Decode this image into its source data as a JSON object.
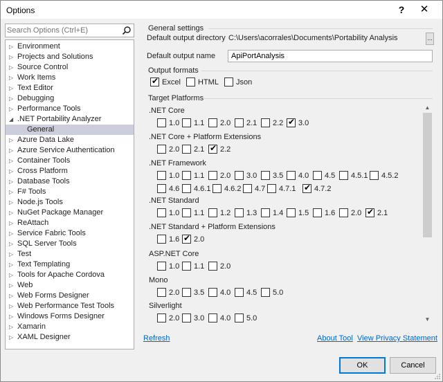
{
  "window": {
    "title": "Options",
    "help_glyph": "?",
    "close_glyph": "✕"
  },
  "search": {
    "placeholder": "Search Options (Ctrl+E)"
  },
  "tree": [
    {
      "label": "Environment",
      "expanded": false
    },
    {
      "label": "Projects and Solutions",
      "expanded": false
    },
    {
      "label": "Source Control",
      "expanded": false
    },
    {
      "label": "Work Items",
      "expanded": false
    },
    {
      "label": "Text Editor",
      "expanded": false
    },
    {
      "label": "Debugging",
      "expanded": false
    },
    {
      "label": "Performance Tools",
      "expanded": false
    },
    {
      "label": ".NET Portability Analyzer",
      "expanded": true
    },
    {
      "label": "General",
      "child": true,
      "selected": true
    },
    {
      "label": "Azure Data Lake",
      "expanded": false
    },
    {
      "label": "Azure Service Authentication",
      "expanded": false
    },
    {
      "label": "Container Tools",
      "expanded": false
    },
    {
      "label": "Cross Platform",
      "expanded": false
    },
    {
      "label": "Database Tools",
      "expanded": false
    },
    {
      "label": "F# Tools",
      "expanded": false
    },
    {
      "label": "Node.js Tools",
      "expanded": false
    },
    {
      "label": "NuGet Package Manager",
      "expanded": false
    },
    {
      "label": "ReAttach",
      "expanded": false
    },
    {
      "label": "Service Fabric Tools",
      "expanded": false
    },
    {
      "label": "SQL Server Tools",
      "expanded": false
    },
    {
      "label": "Test",
      "expanded": false
    },
    {
      "label": "Text Templating",
      "expanded": false
    },
    {
      "label": "Tools for Apache Cordova",
      "expanded": false
    },
    {
      "label": "Web",
      "expanded": false
    },
    {
      "label": "Web Forms Designer",
      "expanded": false
    },
    {
      "label": "Web Performance Test Tools",
      "expanded": false
    },
    {
      "label": "Windows Forms Designer",
      "expanded": false
    },
    {
      "label": "Xamarin",
      "expanded": false
    },
    {
      "label": "XAML Designer",
      "expanded": false
    }
  ],
  "general": {
    "title": "General settings",
    "dir_label": "Default output directory",
    "dir_value": "C:\\Users\\acorrales\\Documents\\Portability Analysis",
    "browse_label": "...",
    "name_label": "Default output name",
    "name_value": "ApiPortAnalysis"
  },
  "formats": {
    "title": "Output formats",
    "items": [
      {
        "label": "Excel",
        "checked": true
      },
      {
        "label": "HTML",
        "checked": false
      },
      {
        "label": "Json",
        "checked": false
      }
    ]
  },
  "platforms": {
    "title": "Target Platforms",
    "groups": [
      {
        "name": ".NET Core",
        "rows": [
          [
            {
              "v": "1.0",
              "c": false
            },
            {
              "v": "1.1",
              "c": false
            },
            {
              "v": "2.0",
              "c": false
            },
            {
              "v": "2.1",
              "c": false
            },
            {
              "v": "2.2",
              "c": false
            },
            {
              "v": "3.0",
              "c": true
            }
          ]
        ]
      },
      {
        "name": ".NET Core + Platform Extensions",
        "rows": [
          [
            {
              "v": "2.0",
              "c": false
            },
            {
              "v": "2.1",
              "c": false
            },
            {
              "v": "2.2",
              "c": true
            }
          ]
        ]
      },
      {
        "name": ".NET Framework",
        "rows": [
          [
            {
              "v": "1.0",
              "c": false
            },
            {
              "v": "1.1",
              "c": false
            },
            {
              "v": "2.0",
              "c": false
            },
            {
              "v": "3.0",
              "c": false
            },
            {
              "v": "3.5",
              "c": false
            },
            {
              "v": "4.0",
              "c": false
            },
            {
              "v": "4.5",
              "c": false
            },
            {
              "v": "4.5.1",
              "c": false
            },
            {
              "v": "4.5.2",
              "c": false
            }
          ],
          [
            {
              "v": "4.6",
              "c": false
            },
            {
              "v": "4.6.1",
              "c": false
            },
            {
              "v": "4.6.2",
              "c": false
            },
            {
              "v": "4.7",
              "c": false
            },
            {
              "v": "4.7.1",
              "c": false
            },
            {
              "v": "4.7.2",
              "c": true
            }
          ]
        ]
      },
      {
        "name": ".NET Standard",
        "rows": [
          [
            {
              "v": "1.0",
              "c": false
            },
            {
              "v": "1.1",
              "c": false
            },
            {
              "v": "1.2",
              "c": false
            },
            {
              "v": "1.3",
              "c": false
            },
            {
              "v": "1.4",
              "c": false
            },
            {
              "v": "1.5",
              "c": false
            },
            {
              "v": "1.6",
              "c": false
            },
            {
              "v": "2.0",
              "c": false
            },
            {
              "v": "2.1",
              "c": true
            }
          ]
        ]
      },
      {
        "name": ".NET Standard + Platform Extensions",
        "rows": [
          [
            {
              "v": "1.6",
              "c": false
            },
            {
              "v": "2.0",
              "c": true
            }
          ]
        ]
      },
      {
        "name": "ASP.NET Core",
        "rows": [
          [
            {
              "v": "1.0",
              "c": false
            },
            {
              "v": "1.1",
              "c": false
            },
            {
              "v": "2.0",
              "c": false
            }
          ]
        ]
      },
      {
        "name": "Mono",
        "rows": [
          [
            {
              "v": "2.0",
              "c": false
            },
            {
              "v": "3.5",
              "c": false
            },
            {
              "v": "4.0",
              "c": false
            },
            {
              "v": "4.5",
              "c": false
            },
            {
              "v": "5.0",
              "c": false
            }
          ]
        ]
      },
      {
        "name": "Silverlight",
        "rows": [
          [
            {
              "v": "2.0",
              "c": false
            },
            {
              "v": "3.0",
              "c": false
            },
            {
              "v": "4.0",
              "c": false
            },
            {
              "v": "5.0",
              "c": false
            }
          ]
        ]
      }
    ]
  },
  "links": {
    "refresh": "Refresh",
    "about": "About Tool",
    "privacy": "View Privacy Statement"
  },
  "buttons": {
    "ok": "OK",
    "cancel": "Cancel"
  },
  "colors": {
    "link": "#0066cc",
    "selection": "#cccedb",
    "ok_border": "#0078d7"
  }
}
